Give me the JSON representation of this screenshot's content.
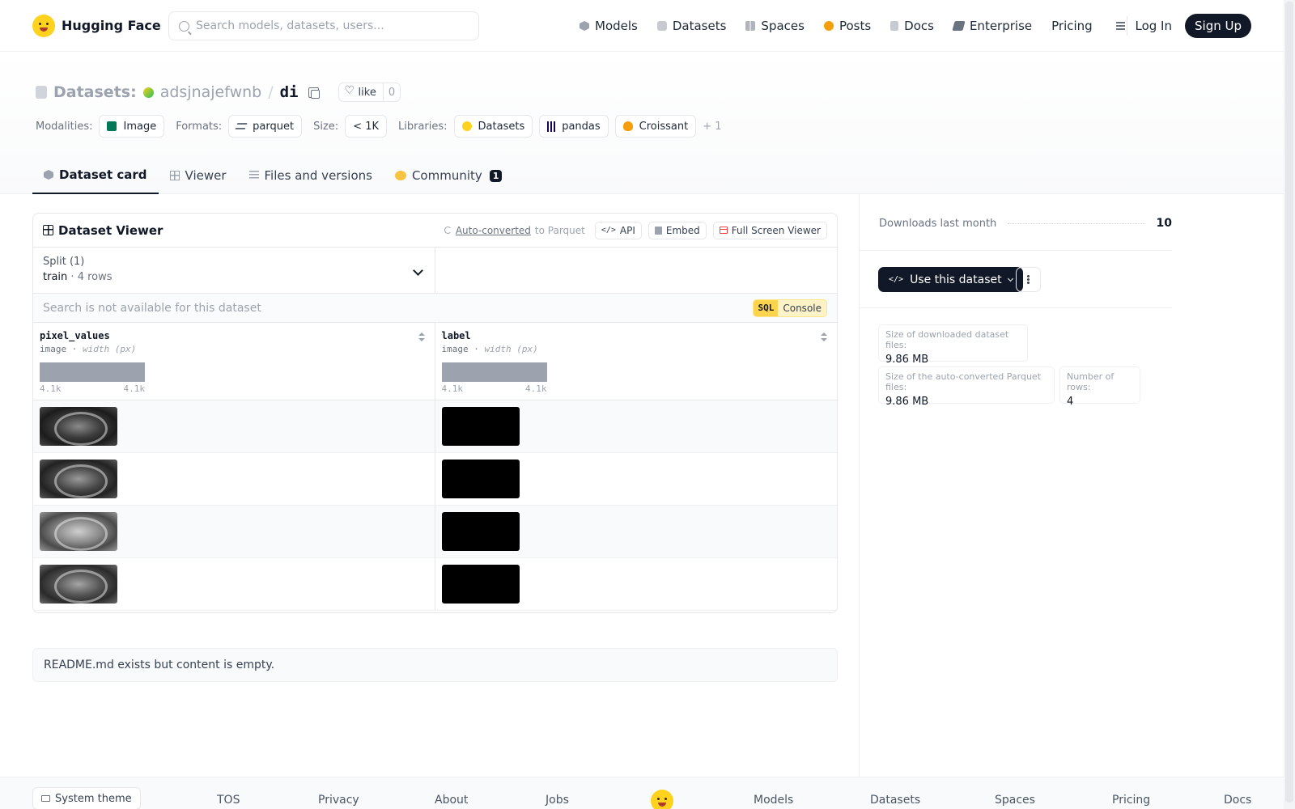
{
  "brand": {
    "name": "Hugging Face"
  },
  "search": {
    "placeholder": "Search models, datasets, users..."
  },
  "nav": {
    "models": "Models",
    "datasets": "Datasets",
    "spaces": "Spaces",
    "posts": "Posts",
    "docs": "Docs",
    "enterprise": "Enterprise",
    "pricing": "Pricing",
    "login": "Log In",
    "signup": "Sign Up"
  },
  "header": {
    "type": "Datasets:",
    "owner": "adsjnajefwnb",
    "separator": "/",
    "name": "di",
    "like_label": "like",
    "like_count": "0"
  },
  "meta": {
    "modalities_label": "Modalities:",
    "modality": "Image",
    "formats_label": "Formats:",
    "format": "parquet",
    "size_label": "Size:",
    "size": "< 1K",
    "libraries_label": "Libraries:",
    "libraries": [
      "Datasets",
      "pandas",
      "Croissant"
    ],
    "more": "+ 1"
  },
  "tabs": {
    "card": "Dataset card",
    "viewer": "Viewer",
    "files": "Files and versions",
    "community": "Community",
    "community_count": "1"
  },
  "viewer": {
    "title": "Dataset Viewer",
    "auto_converted": "Auto-converted",
    "to_parquet": "to Parquet",
    "api": "API",
    "embed": "Embed",
    "fullscreen": "Full Screen Viewer",
    "split_label": "Split (1)",
    "split_name": "train",
    "split_dot": "·",
    "split_rows": "4 rows",
    "search_na": "Search is not available for this dataset",
    "sql": "SQL",
    "console": "Console",
    "columns": [
      {
        "name": "pixel_values",
        "type": "image",
        "sep": "·",
        "subtype": "width (px)",
        "min": "4.1k",
        "max": "4.1k"
      },
      {
        "name": "label",
        "type": "image",
        "sep": "·",
        "subtype": "width (px)",
        "min": "4.1k",
        "max": "4.1k"
      }
    ],
    "row_count": 4
  },
  "readme": {
    "text": "README.md exists but content is empty."
  },
  "sidebar": {
    "downloads_label": "Downloads last month",
    "downloads_value": "10",
    "use_dataset": "Use this dataset",
    "stats": [
      {
        "label": "Size of downloaded dataset files:",
        "value": "9.86 MB"
      },
      {
        "label": "Size of the auto-converted Parquet files:",
        "value": "9.86 MB"
      },
      {
        "label": "Number of rows:",
        "value": "4"
      }
    ]
  },
  "footer": {
    "theme": "System theme",
    "links": [
      "TOS",
      "Privacy",
      "About",
      "Jobs",
      "Models",
      "Datasets",
      "Spaces",
      "Pricing",
      "Docs"
    ]
  },
  "colors": {
    "accent_dark": "#111827",
    "hf_yellow": "#ffd21e",
    "sql_yellow": "#fcd34d"
  }
}
